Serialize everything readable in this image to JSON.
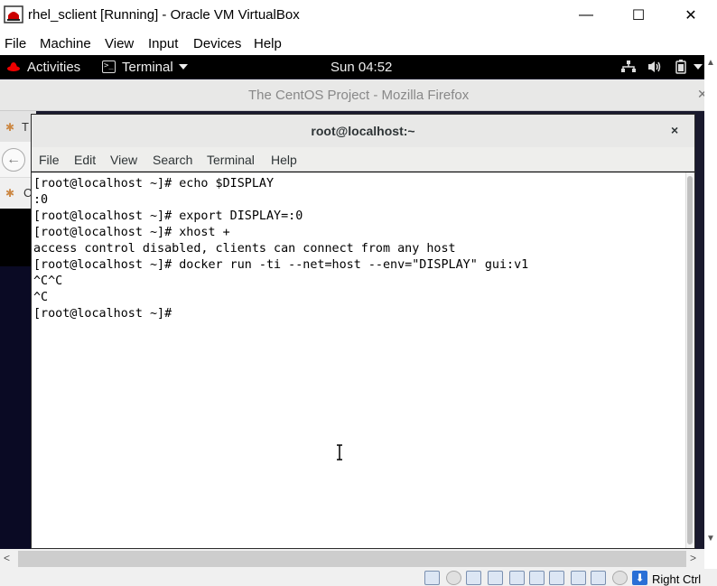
{
  "window": {
    "title": "rhel_sclient [Running] - Oracle VM VirtualBox",
    "minimize": "—",
    "maximize": "☐",
    "close": "✕"
  },
  "vbox_menu": [
    "File",
    "Machine",
    "View",
    "Input",
    "Devices",
    "Help"
  ],
  "gnome": {
    "activities": "Activities",
    "app_menu": "Terminal",
    "clock": "Sun 04:52"
  },
  "firefox": {
    "title": "The CentOS Project - Mozilla Firefox",
    "tab_fragment": "T",
    "bookmark_fragment": "C"
  },
  "terminal": {
    "title": "root@localhost:~",
    "close": "×",
    "menu": [
      "File",
      "Edit",
      "View",
      "Search",
      "Terminal",
      "Help"
    ],
    "lines": [
      "[root@localhost ~]# echo $DISPLAY",
      ":0",
      "[root@localhost ~]# export DISPLAY=:0",
      "[root@localhost ~]# xhost +",
      "access control disabled, clients can connect from any host",
      "[root@localhost ~]# docker run -ti --net=host --env=\"DISPLAY\" gui:v1",
      "^C^C",
      "^C",
      "[root@localhost ~]#"
    ]
  },
  "statusbar": {
    "host_key": "Right Ctrl"
  }
}
